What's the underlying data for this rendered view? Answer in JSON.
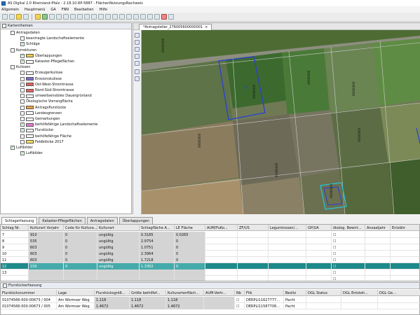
{
  "window": {
    "title": "AS Digital 2.0 Rheinland-Pfalz - 2.18.10.RP-5887 - FlächenNutzungsNachweis"
  },
  "menu": [
    "Allgemein",
    "Hauptmenü",
    "GA",
    "FNN",
    "Bearbeiten",
    "Hilfe"
  ],
  "left_panel": {
    "title": "Kartenthemen",
    "items": [
      {
        "label": "Antragsdaten",
        "checked": false,
        "indent": 1,
        "swatch": ""
      },
      {
        "label": "beantragte Landschaftselemente",
        "checked": false,
        "indent": 2,
        "swatch": ""
      },
      {
        "label": "Schläge",
        "checked": true,
        "indent": 2,
        "swatch": ""
      },
      {
        "label": "Korrekturen",
        "checked": false,
        "indent": 1,
        "swatch": ""
      },
      {
        "label": "Überlappungen",
        "checked": true,
        "indent": 2,
        "swatch": "#f5c842"
      },
      {
        "label": "Kataster-Pflegeflächen",
        "checked": true,
        "indent": 2,
        "swatch": "#ffffff"
      },
      {
        "label": "Kulissen",
        "checked": false,
        "indent": 1,
        "swatch": ""
      },
      {
        "label": "Erzeugerkulisse",
        "checked": false,
        "indent": 2,
        "swatch": "#ffffff"
      },
      {
        "label": "Erosionskulisse",
        "checked": false,
        "indent": 2,
        "swatch": "#7a6fd0"
      },
      {
        "label": "Ost-West-Stromtrasse",
        "checked": false,
        "indent": 2,
        "swatch": "#e86060"
      },
      {
        "label": "Nord-Süd-Stromtrasse",
        "checked": false,
        "indent": 2,
        "swatch": "#e86060"
      },
      {
        "label": "umweltsensibles Dauergrünland",
        "checked": false,
        "indent": 2,
        "swatch": "#ffffff"
      },
      {
        "label": "Ökologische Vorrangfläche",
        "checked": false,
        "indent": 2,
        "swatch": ""
      },
      {
        "label": "Antragsflurstücke",
        "checked": false,
        "indent": 2,
        "swatch": "#f0a040"
      },
      {
        "label": "Landesgrenzen",
        "checked": false,
        "indent": 2,
        "swatch": "#ffffff"
      },
      {
        "label": "Gemarkungen",
        "checked": false,
        "indent": 2,
        "swatch": "#ffffff"
      },
      {
        "label": "beihilfefähige Landschaftselemente",
        "checked": true,
        "indent": 2,
        "swatch": "#e87ad0"
      },
      {
        "label": "Flurstücke",
        "checked": true,
        "indent": 2,
        "swatch": "#ffffff"
      },
      {
        "label": "beihilfefähige Fläche",
        "checked": false,
        "indent": 2,
        "swatch": "#ffffff"
      },
      {
        "label": "Feldblöcke 2017",
        "checked": false,
        "indent": 2,
        "swatch": "#f5e35a"
      },
      {
        "label": "Luftbilder",
        "checked": true,
        "indent": 1,
        "swatch": ""
      },
      {
        "label": "Luftbilder",
        "checked": true,
        "indent": 2,
        "swatch": ""
      }
    ]
  },
  "map": {
    "tab": "*Antragsteller_276005600000001",
    "labels": [
      "00000000",
      "00000000",
      "00000000",
      "00000000",
      "00000000",
      "00000000",
      "00000000",
      "00000000",
      "14"
    ]
  },
  "bottom_tabs": [
    "Schlagerfassung",
    "Kataster-Pflegeflächen",
    "Antragsdaten",
    "Überlappungen"
  ],
  "table1": {
    "columns": [
      "Schlag Nr.",
      "Kulturart Vorjahr",
      "Code für Kultura...",
      "Kulturart",
      "Schlagfläche A...",
      "LE Fläche",
      "AUM/FuKo...",
      "ZF/US",
      "Leguminosen/...",
      "GP/UA",
      "ökolog. Bewirt...",
      "Ansaatjahr",
      "Entzähr"
    ],
    "rows": [
      [
        "7",
        "910",
        "0",
        "ungültig",
        "0.3185",
        "0.0265",
        "",
        "",
        "",
        "",
        "☐",
        "",
        ""
      ],
      [
        "8",
        "535",
        "0",
        "ungültig",
        "2.9754",
        "0",
        "",
        "",
        "",
        "",
        "☐",
        "",
        ""
      ],
      [
        "9",
        "603",
        "0",
        "ungültig",
        "1.0751",
        "0",
        "",
        "",
        "",
        "",
        "☐",
        "",
        ""
      ],
      [
        "10",
        "603",
        "0",
        "ungültig",
        "2.3964",
        "0",
        "",
        "",
        "",
        "",
        "☐",
        "",
        ""
      ],
      [
        "11",
        "603",
        "0",
        "ungültig",
        "1.7218",
        "0",
        "",
        "",
        "",
        "",
        "☐",
        "",
        ""
      ],
      [
        "12",
        "150",
        "0",
        "ungültig",
        "1.3362",
        "0",
        "",
        "",
        "",
        "",
        "☐",
        "",
        ""
      ],
      [
        "13",
        "",
        "",
        "",
        "",
        "",
        "",
        "",
        "",
        "",
        "☐",
        "",
        ""
      ],
      [
        "",
        "",
        "",
        "",
        "",
        "",
        "",
        "",
        "",
        "",
        "☐",
        "",
        ""
      ]
    ]
  },
  "section2": {
    "title": "Flurstückerfassung",
    "columns": [
      "Flurstücksnummer",
      "Lage",
      "Flurstücksgröß...",
      "Größe beihilfef...",
      "Kulturartenfläch...",
      "AUM-Vertr...",
      "Nb",
      "Flik",
      "Besitz",
      "DGL Status",
      "DGL Entsteh...",
      "DGL Ge..."
    ],
    "rows": [
      [
        "01074566-000-00673 / 004",
        "Am Wormser Weg",
        "1.118",
        "1.118",
        "1.118",
        "",
        "☐",
        "DERPLI11627777...",
        "Pacht",
        "",
        "",
        ""
      ],
      [
        "01074566-000-00673 / 005",
        "Am Wormser Weg",
        "1.4672",
        "1.4672",
        "1.4672",
        "",
        "☐",
        "DERPLI11587708...",
        "Pacht",
        "",
        "",
        ""
      ]
    ]
  }
}
